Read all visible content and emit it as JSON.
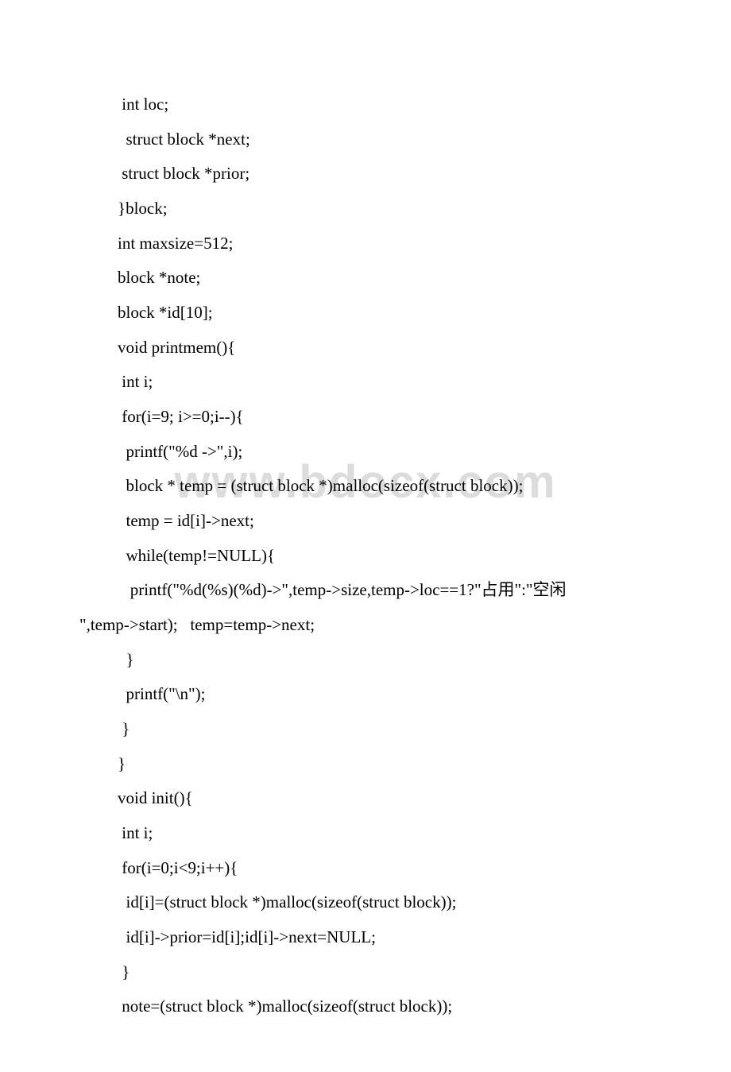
{
  "watermark": "www.bdocx.com",
  "code": {
    "lines": [
      {
        "text": " int loc;",
        "cls": "indent-1"
      },
      {
        "text": "  struct block *next;",
        "cls": "indent-1"
      },
      {
        "text": " struct block *prior;",
        "cls": "indent-1"
      },
      {
        "text": "}block;",
        "cls": "indent-1"
      },
      {
        "text": "int maxsize=512;",
        "cls": "indent-1"
      },
      {
        "text": "block *note;",
        "cls": "indent-1"
      },
      {
        "text": "block *id[10];",
        "cls": "indent-1"
      },
      {
        "text": "void printmem(){",
        "cls": "indent-1"
      },
      {
        "text": " int i;",
        "cls": "indent-1"
      },
      {
        "text": " for(i=9; i>=0;i--){",
        "cls": "indent-1"
      },
      {
        "text": "  printf(\"%d ->\",i);",
        "cls": "indent-1"
      },
      {
        "text": "  block * temp = (struct block *)malloc(sizeof(struct block));",
        "cls": "indent-1"
      },
      {
        "text": "  temp = id[i]->next;",
        "cls": "indent-1"
      },
      {
        "text": "  while(temp!=NULL){",
        "cls": "indent-1"
      },
      {
        "text": "   printf(\"%d(%s)(%d)->\",temp->size,temp->loc==1?\"占用\":\"空闲",
        "cls": "indent-1"
      },
      {
        "text": "\",temp->start);   temp=temp->next;",
        "cls": "wrap-line"
      },
      {
        "text": "  }",
        "cls": "indent-1"
      },
      {
        "text": "  printf(\"\\n\");",
        "cls": "indent-1"
      },
      {
        "text": " }",
        "cls": "indent-1"
      },
      {
        "text": "}",
        "cls": "indent-1"
      },
      {
        "text": "void init(){",
        "cls": "indent-1"
      },
      {
        "text": " int i;",
        "cls": "indent-1"
      },
      {
        "text": " for(i=0;i<9;i++){",
        "cls": "indent-1"
      },
      {
        "text": "  id[i]=(struct block *)malloc(sizeof(struct block));",
        "cls": "indent-1"
      },
      {
        "text": "  id[i]->prior=id[i];id[i]->next=NULL;",
        "cls": "indent-1"
      },
      {
        "text": " }",
        "cls": "indent-1"
      },
      {
        "text": " note=(struct block *)malloc(sizeof(struct block));",
        "cls": "indent-1"
      }
    ]
  }
}
